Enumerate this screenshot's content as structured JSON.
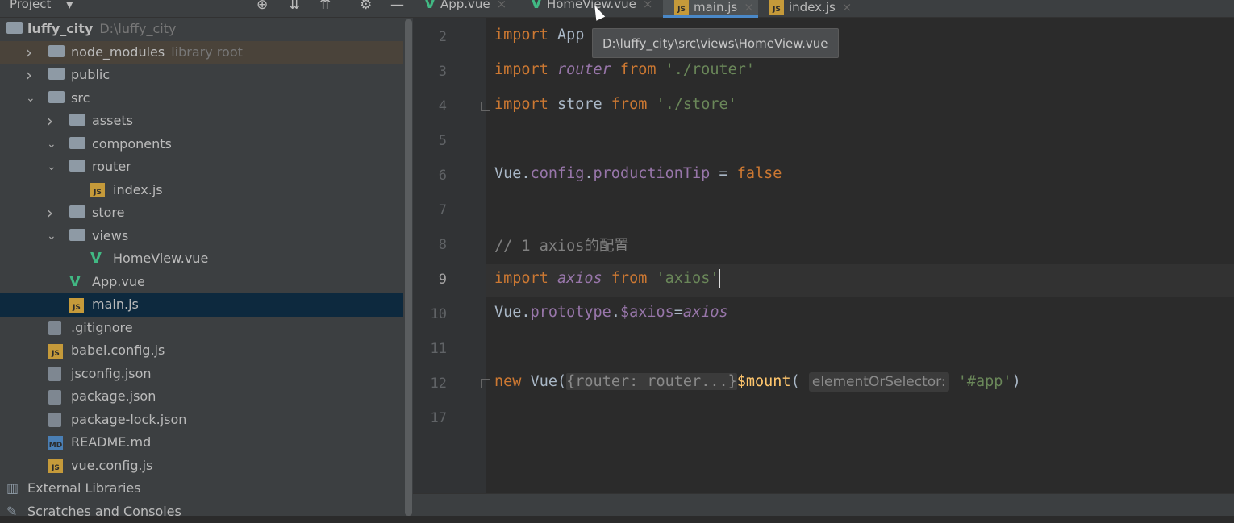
{
  "project_panel": {
    "title": "Project",
    "toolbar_icons": [
      "locate-icon",
      "expand-all-icon",
      "collapse-all-icon",
      "gear-icon",
      "minimize-icon"
    ]
  },
  "tree": [
    {
      "name": "luffy_city",
      "hint": "D:\\luffy_city",
      "type": "folder",
      "depth": 0,
      "expanded": true
    },
    {
      "name": "node_modules",
      "hint": "library root",
      "type": "folder",
      "depth": 1,
      "expanded": false
    },
    {
      "name": "public",
      "hint": "",
      "type": "folder",
      "depth": 1,
      "expanded": false
    },
    {
      "name": "src",
      "hint": "",
      "type": "folder",
      "depth": 1,
      "expanded": true
    },
    {
      "name": "assets",
      "hint": "",
      "type": "folder",
      "depth": 2,
      "expanded": false
    },
    {
      "name": "components",
      "hint": "",
      "type": "folder",
      "depth": 2,
      "expanded": true
    },
    {
      "name": "router",
      "hint": "",
      "type": "folder",
      "depth": 2,
      "expanded": true
    },
    {
      "name": "index.js",
      "hint": "",
      "type": "js",
      "depth": 3
    },
    {
      "name": "store",
      "hint": "",
      "type": "folder",
      "depth": 2,
      "expanded": false
    },
    {
      "name": "views",
      "hint": "",
      "type": "folder",
      "depth": 2,
      "expanded": true
    },
    {
      "name": "HomeView.vue",
      "hint": "",
      "type": "vue",
      "depth": 3
    },
    {
      "name": "App.vue",
      "hint": "",
      "type": "vue",
      "depth": 2
    },
    {
      "name": "main.js",
      "hint": "",
      "type": "js",
      "depth": 2,
      "selected": true
    },
    {
      "name": ".gitignore",
      "hint": "",
      "type": "file",
      "depth": 1
    },
    {
      "name": "babel.config.js",
      "hint": "",
      "type": "js",
      "depth": 1
    },
    {
      "name": "jsconfig.json",
      "hint": "",
      "type": "file",
      "depth": 1
    },
    {
      "name": "package.json",
      "hint": "",
      "type": "file",
      "depth": 1
    },
    {
      "name": "package-lock.json",
      "hint": "",
      "type": "file",
      "depth": 1
    },
    {
      "name": "README.md",
      "hint": "",
      "type": "md",
      "depth": 1
    },
    {
      "name": "vue.config.js",
      "hint": "",
      "type": "js",
      "depth": 1
    },
    {
      "name": "External Libraries",
      "hint": "",
      "type": "lib",
      "depth": 0
    },
    {
      "name": "Scratches and Consoles",
      "hint": "",
      "type": "scratch",
      "depth": 0
    }
  ],
  "tabs": [
    {
      "label": "App.vue",
      "type": "vue",
      "active": false
    },
    {
      "label": "HomeView.vue",
      "type": "vue",
      "active": false
    },
    {
      "label": "main.js",
      "type": "js",
      "active": true
    },
    {
      "label": "index.js",
      "type": "js",
      "active": false
    }
  ],
  "tooltip": "D:\\luffy_city\\src\\views\\HomeView.vue",
  "code": {
    "current_line": "9",
    "lines": [
      {
        "n": "2",
        "tokens": [
          [
            "kw",
            "import "
          ],
          [
            "",
            "App"
          ]
        ]
      },
      {
        "n": "3",
        "tokens": [
          [
            "kw",
            "import "
          ],
          [
            "pv",
            "router"
          ],
          [
            "kw",
            " from "
          ],
          [
            "st",
            "'./router'"
          ]
        ]
      },
      {
        "n": "4",
        "tokens": [
          [
            "kw",
            "import "
          ],
          [
            "",
            "store"
          ],
          [
            "kw",
            " from "
          ],
          [
            "st",
            "'./store'"
          ]
        ]
      },
      {
        "n": "5",
        "tokens": []
      },
      {
        "n": "6",
        "tokens": [
          [
            "",
            "Vue."
          ],
          [
            "pf",
            "config"
          ],
          [
            "",
            "."
          ],
          [
            "pf",
            "productionTip"
          ],
          [
            "",
            " = "
          ],
          [
            "kw",
            "false"
          ]
        ]
      },
      {
        "n": "7",
        "tokens": []
      },
      {
        "n": "8",
        "tokens": [
          [
            "cm",
            "// 1 axios的配置"
          ]
        ]
      },
      {
        "n": "9",
        "tokens": [
          [
            "kw",
            "import "
          ],
          [
            "pv",
            "axios"
          ],
          [
            "kw",
            " from "
          ],
          [
            "st",
            "'axios'"
          ]
        ]
      },
      {
        "n": "10",
        "tokens": [
          [
            "",
            "Vue."
          ],
          [
            "pf",
            "prototype"
          ],
          [
            "",
            "."
          ],
          [
            "pf",
            "$axios"
          ],
          [
            "",
            "="
          ],
          [
            "pv",
            "axios"
          ]
        ]
      },
      {
        "n": "11",
        "tokens": []
      },
      {
        "n": "12",
        "tokens": [
          [
            "kw",
            "new "
          ],
          [
            "",
            "Vue("
          ],
          [
            "fold",
            "{router: router...}"
          ],
          [
            ")."
          ],
          [
            "fn",
            "$mount"
          ],
          [
            "",
            "( "
          ],
          [
            "hintbox",
            "elementOrSelector:"
          ],
          [
            "",
            " "
          ],
          [
            "st",
            "'#app'"
          ],
          [
            "",
            ")"
          ]
        ]
      },
      {
        "n": "17",
        "tokens": []
      }
    ]
  },
  "colors": {
    "keyword": "#cc7832",
    "property": "#9876aa",
    "string": "#6a8759",
    "comment": "#808080",
    "method": "#ffc66d",
    "text": "#a9b7c6",
    "selection": "#0d293e",
    "tab_underline": "#4a88c7"
  }
}
